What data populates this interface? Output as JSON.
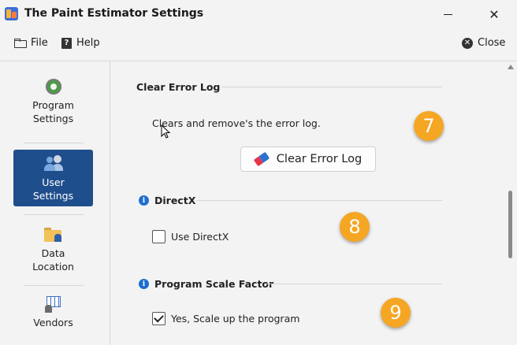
{
  "window": {
    "title": "The Paint Estimator Settings",
    "min_glyph": "—",
    "max_glyph": "□",
    "close_glyph": "✕"
  },
  "menu": {
    "file": "File",
    "help": "Help",
    "close": "Close"
  },
  "sidebar": {
    "items": [
      {
        "label1": "Program",
        "label2": "Settings",
        "icon": "gear-icon",
        "selected": false
      },
      {
        "label1": "User",
        "label2": "Settings",
        "icon": "users-gear-icon",
        "selected": true
      },
      {
        "label1": "Data",
        "label2": "Location",
        "icon": "folder-user-icon",
        "selected": false
      },
      {
        "label1": "Vendors",
        "label2": "",
        "icon": "vendor-table-icon",
        "selected": false
      }
    ]
  },
  "sections": {
    "error_log": {
      "title": "Clear Error Log",
      "description": "Clears and remove's the error log.",
      "button_label": "Clear Error Log",
      "badge": "7"
    },
    "directx": {
      "title": "DirectX",
      "checkbox_label": "Use DirectX",
      "checked": false,
      "badge": "8"
    },
    "scale": {
      "title": "Program Scale Factor",
      "checkbox_label": "Yes, Scale up the program",
      "checked": true,
      "badge": "9"
    }
  },
  "colors": {
    "accent": "#1f4e8c",
    "badge": "#f5a623",
    "info": "#1f6fd1"
  }
}
